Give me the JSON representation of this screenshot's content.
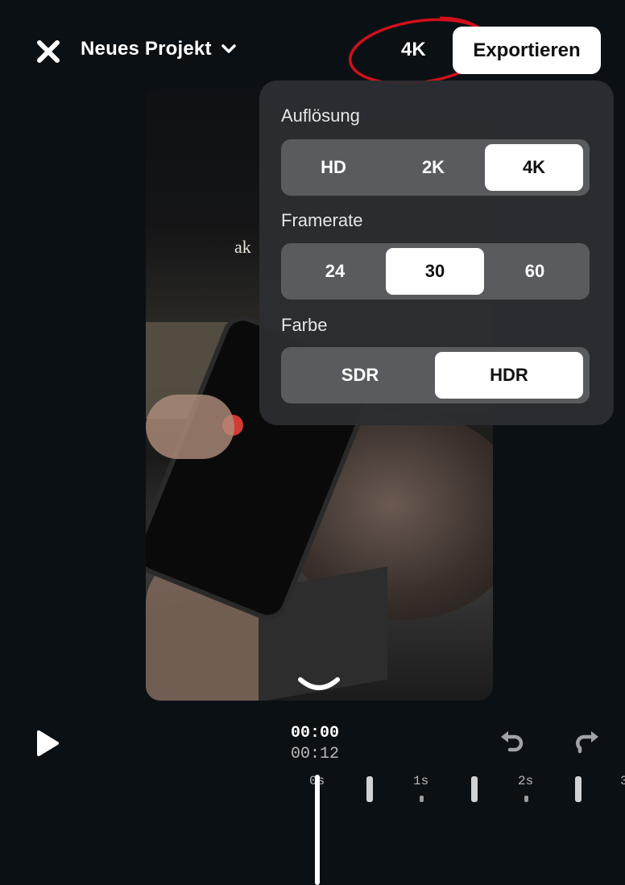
{
  "header": {
    "project_title": "Neues Projekt",
    "resolution_label": "4K",
    "export_label": "Exportieren"
  },
  "preview": {
    "overlay_text": "ak"
  },
  "settings": {
    "resolution": {
      "label": "Auflösung",
      "options": [
        "HD",
        "2K",
        "4K"
      ],
      "selected": "4K"
    },
    "framerate": {
      "label": "Framerate",
      "options": [
        "24",
        "30",
        "60"
      ],
      "selected": "30"
    },
    "color": {
      "label": "Farbe",
      "options": [
        "SDR",
        "HDR"
      ],
      "selected": "HDR"
    }
  },
  "playback": {
    "current_time": "00:00",
    "total_time": "00:12"
  },
  "timeline": {
    "labels": [
      "0s",
      "1s",
      "2s",
      "3"
    ]
  },
  "icons": {
    "close": "close-icon",
    "dropdown": "chevron-down-icon",
    "collapse": "chevron-down-icon",
    "play": "play-icon",
    "undo": "undo-icon",
    "redo": "redo-icon"
  },
  "colors": {
    "background": "#0b1014",
    "panel": "#2c2e32",
    "segment_bg": "#5a5b5e",
    "selected": "#ffffff",
    "annotation_circle": "#d0101a"
  }
}
